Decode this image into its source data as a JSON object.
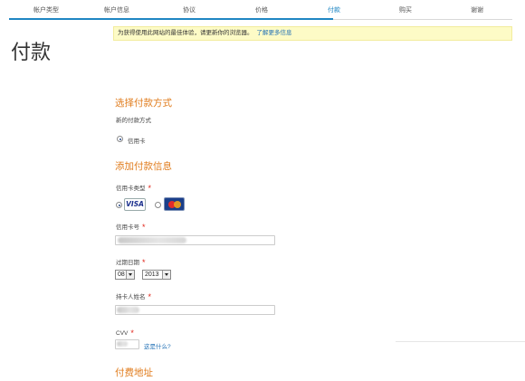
{
  "steps": [
    {
      "label": "帐户类型",
      "active": false
    },
    {
      "label": "帐户信息",
      "active": false
    },
    {
      "label": "协议",
      "active": false
    },
    {
      "label": "价格",
      "active": false
    },
    {
      "label": "付款",
      "active": true
    },
    {
      "label": "购买",
      "active": false
    },
    {
      "label": "谢谢",
      "active": false
    }
  ],
  "page_title": "付款",
  "notice": {
    "text": "为获得使用此网站的最佳体验，请更新你的浏览器。",
    "link": "了解更多信息"
  },
  "payment_method": {
    "heading": "选择付款方式",
    "subheading": "新的付款方式",
    "option_label": "信用卡"
  },
  "payment_info": {
    "heading": "添加付款信息",
    "card_type_label": "信用卡类型",
    "card_types": [
      "VISA",
      "MasterCard"
    ],
    "card_number_label": "信用卡号",
    "expiry_label": "过期日期",
    "expiry_month": "08",
    "expiry_year": "2013",
    "cardholder_label": "持卡人姓名",
    "cvv_label": "CVV",
    "cvv_help_link": "这是什么?",
    "required_marker": "*"
  },
  "billing": {
    "heading": "付费地址"
  },
  "colors": {
    "accent_blue": "#1f86c3",
    "heading_orange": "#e07b1b",
    "required_red": "#e0261b",
    "notice_bg": "#fdfbc6"
  }
}
